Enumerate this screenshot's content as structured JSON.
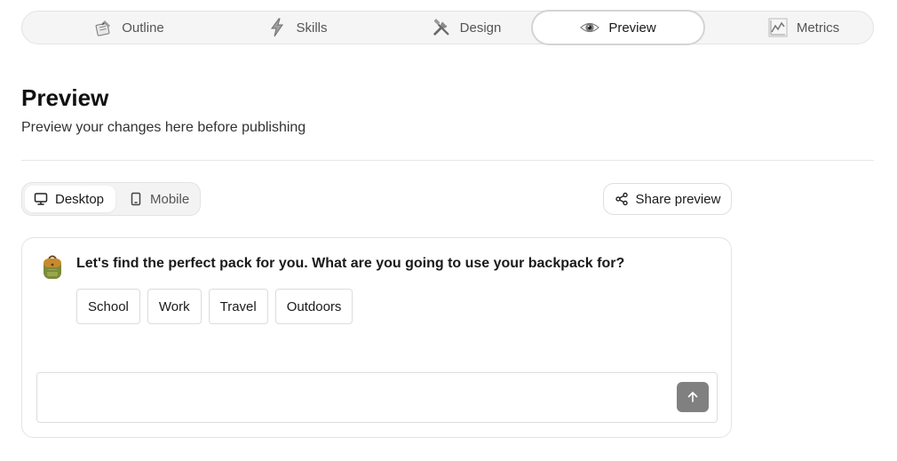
{
  "tabs": [
    {
      "label": "Outline",
      "icon": "notepad-icon",
      "active": false
    },
    {
      "label": "Skills",
      "icon": "lightning-icon",
      "active": false
    },
    {
      "label": "Design",
      "icon": "tools-icon",
      "active": false
    },
    {
      "label": "Preview",
      "icon": "eye-icon",
      "active": true
    },
    {
      "label": "Metrics",
      "icon": "chart-icon",
      "active": false
    }
  ],
  "header": {
    "title": "Preview",
    "subtitle": "Preview your changes here before publishing"
  },
  "device_toggle": {
    "desktop_label": "Desktop",
    "mobile_label": "Mobile",
    "selected": "Desktop"
  },
  "share": {
    "label": "Share preview"
  },
  "chat": {
    "avatar_icon": "backpack-icon",
    "question": "Let's find the perfect pack for you. What are you going to use your backpack for?",
    "options": [
      "School",
      "Work",
      "Travel",
      "Outdoors"
    ],
    "input_value": "",
    "input_placeholder": ""
  },
  "colors": {
    "accent_send": "#808080",
    "tab_bar_bg": "#f5f5f5",
    "border": "#e3e3e3"
  }
}
